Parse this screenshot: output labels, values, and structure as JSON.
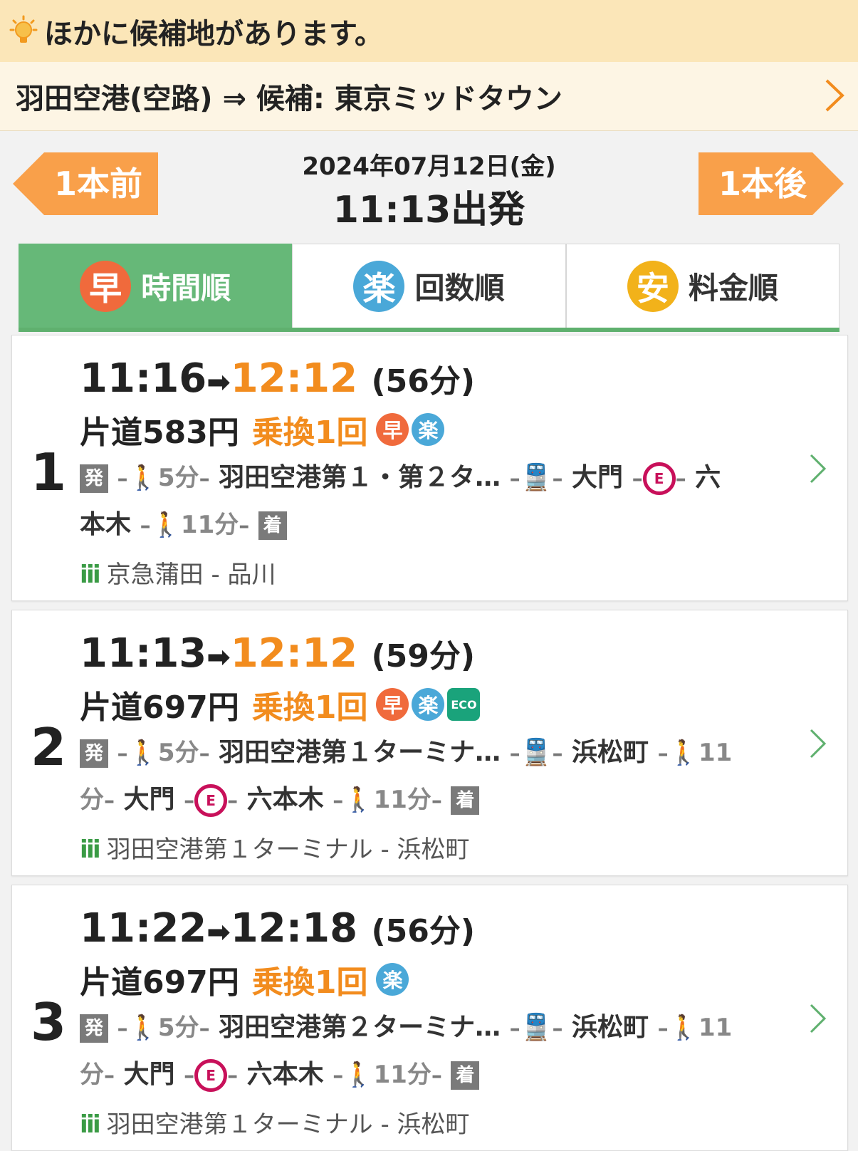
{
  "alert": {
    "text": "ほかに候補地があります。"
  },
  "candidate": {
    "text": "羽田空港(空路) ⇒ 候補: 東京ミッドタウン"
  },
  "nav": {
    "prev_label": "1本前",
    "next_label": "1本後",
    "date": "2024年07月12日(金)",
    "departure": "11:13出発"
  },
  "tabs": [
    {
      "badge": "早",
      "label": "時間順",
      "color": "#f06a3c",
      "active": true
    },
    {
      "badge": "楽",
      "label": "回数順",
      "color": "#4aa8d8",
      "active": false
    },
    {
      "badge": "安",
      "label": "料金順",
      "color": "#f2b21a",
      "active": false
    }
  ],
  "routes": [
    {
      "no": "1",
      "dep": "11:16",
      "arr": "12:12",
      "duration": "(56分)",
      "fare": "片道583円",
      "transfer": "乗換1回",
      "badges": [
        "早",
        "楽"
      ],
      "eco": "",
      "line1_walk": "5分",
      "line1_station": "羽田空港第１・第２タ…",
      "line1_station2": "大門",
      "line1_tail": "六",
      "line2_head": "本木",
      "line2_walk": "11分",
      "dep_tag": "発",
      "arr_tag": "着",
      "crowd": "京急蒲田 - 品川"
    },
    {
      "no": "2",
      "dep": "11:13",
      "arr": "12:12",
      "duration": "(59分)",
      "fare": "片道697円",
      "transfer": "乗換1回",
      "badges": [
        "早",
        "楽"
      ],
      "eco": "ECO",
      "line1_walk": "5分",
      "line1_station": "羽田空港第１ターミナ…",
      "line1_station2": "浜松町",
      "line1_tail": "11",
      "line2_head": "分",
      "line2_station": "大門",
      "line2_station2": "六本木",
      "line2_walk": "11分",
      "dep_tag": "発",
      "arr_tag": "着",
      "crowd": "羽田空港第１ターミナル - 浜松町"
    },
    {
      "no": "3",
      "dep": "11:22",
      "arr": "12:18",
      "duration": "(56分)",
      "fare": "片道697円",
      "transfer": "乗換1回",
      "badges": [
        "楽"
      ],
      "eco": "",
      "line1_walk": "5分",
      "line1_station": "羽田空港第２ターミナ…",
      "line1_station2": "浜松町",
      "line1_tail": "11",
      "line2_head": "分",
      "line2_station": "大門",
      "line2_station2": "六本木",
      "line2_walk": "11分",
      "dep_tag": "発",
      "arr_tag": "着",
      "crowd": "羽田空港第１ターミナル - 浜松町"
    }
  ],
  "line_e": "E",
  "colors": {
    "accent_orange": "#f28c1e",
    "tab_green": "#66b878",
    "nav_button": "#f9a04a"
  }
}
